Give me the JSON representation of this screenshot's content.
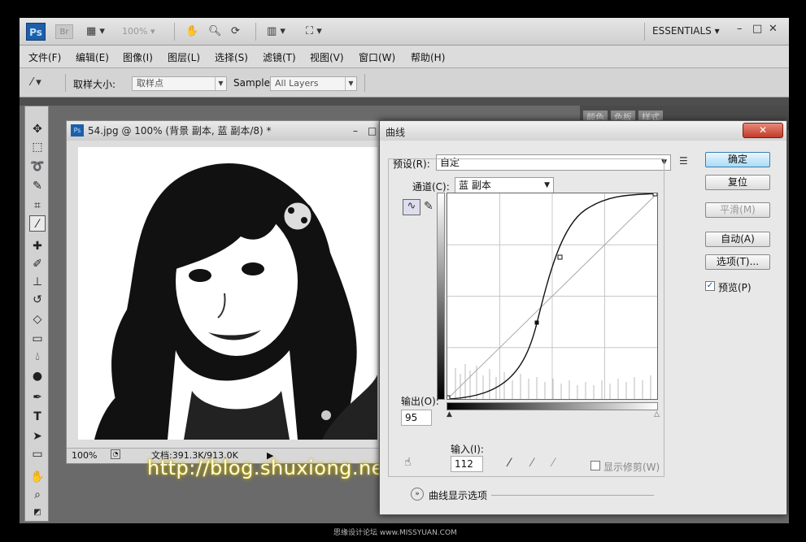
{
  "appbar": {
    "ps_logo": "Ps",
    "br_logo": "Br",
    "zoom": "100%",
    "workspace": "ESSENTIALS",
    "minimize": "–",
    "maximize": "□",
    "close": "✕"
  },
  "menu": [
    "文件(F)",
    "编辑(E)",
    "图像(I)",
    "图层(L)",
    "选择(S)",
    "滤镜(T)",
    "视图(V)",
    "窗口(W)",
    "帮助(H)"
  ],
  "options": {
    "sample_size_label": "取样大小:",
    "sample_size_value": "取样点",
    "sample_label": "Sample:",
    "sample_value": "All Layers"
  },
  "panel_tabs": [
    "颜色",
    "色板",
    "样式"
  ],
  "document": {
    "icon": "Ps",
    "title": "54.jpg @ 100% (背景 副本, 蓝 副本/8) *",
    "zoom": "100%",
    "doc_info": "文档:391.3K/913.0K"
  },
  "watermark_url": "http://blog.shuxiong.net",
  "curves": {
    "title": "曲线",
    "close": "✕",
    "preset_label": "预设(R):",
    "preset_value": "自定",
    "channel_label": "通道(C):",
    "channel_value": "蓝 副本",
    "output_label": "输出(O):",
    "output_value": "95",
    "input_label": "输入(I):",
    "input_value": "112",
    "show_clipping": "显示修剪(W)",
    "display_options": "曲线显示选项",
    "buttons": {
      "ok": "确定",
      "reset": "复位",
      "smooth": "平滑(M)",
      "auto": "自动(A)",
      "options": "选项(T)..."
    },
    "preview_label": "预览(P)",
    "preview_checked": true
  },
  "footer_watermark": "思缘设计论坛 www.MISSYUAN.COM"
}
